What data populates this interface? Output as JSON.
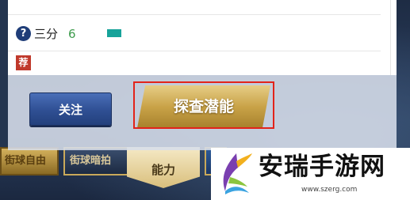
{
  "panel": {
    "help_icon": "?",
    "stat_label": "三分",
    "stat_value": "6",
    "stat_bar_color": "#17a39a",
    "recommend_badge": "荐"
  },
  "buttons": {
    "follow": "关注",
    "explore": "探查潜能"
  },
  "tabs": {
    "left": "街球自由",
    "mid": "街球暗拍",
    "ability": "能力"
  },
  "watermark": {
    "title": "安瑞手游网",
    "url": "www.szerg.com"
  },
  "colors": {
    "highlight": "#e2231a",
    "follow_button": "#2f4f93",
    "explore_button": "#c9a348"
  }
}
